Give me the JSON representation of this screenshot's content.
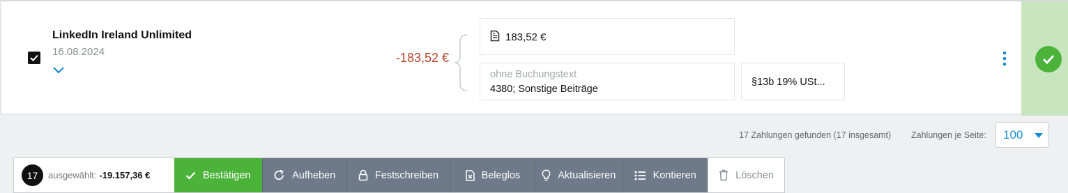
{
  "transaction": {
    "company": "LinkedIn Ireland Unlimited",
    "date": "16.08.2024",
    "amount": "-183,52 €",
    "split_amount": "183,52 €",
    "booking_text_placeholder": "ohne Buchungstext",
    "account": "4380; Sonstige Beiträge",
    "tax_key": "§13b 19% USt...",
    "selected": true,
    "status": "confirmed"
  },
  "pagination": {
    "found_text": "17 Zahlungen gefunden (17 insgesamt)",
    "per_page_label": "Zahlungen je Seite:",
    "per_page_value": "100"
  },
  "bulk_bar": {
    "count": "17",
    "selected_label": "ausgewählt:",
    "selected_sum": "-19.157,36 €",
    "buttons": {
      "confirm": "Bestätigen",
      "unconfirm": "Aufheben",
      "lock": "Festschreiben",
      "no_receipt": "Beleglos",
      "refresh": "Aktualisieren",
      "assign": "Kontieren",
      "delete": "Löschen"
    }
  },
  "colors": {
    "accent_blue": "#1a8ad4",
    "negative_red": "#b5432b",
    "confirm_green": "#4cb33a",
    "confirm_strip": "#c7e6be",
    "action_gray": "#6e7a89"
  }
}
